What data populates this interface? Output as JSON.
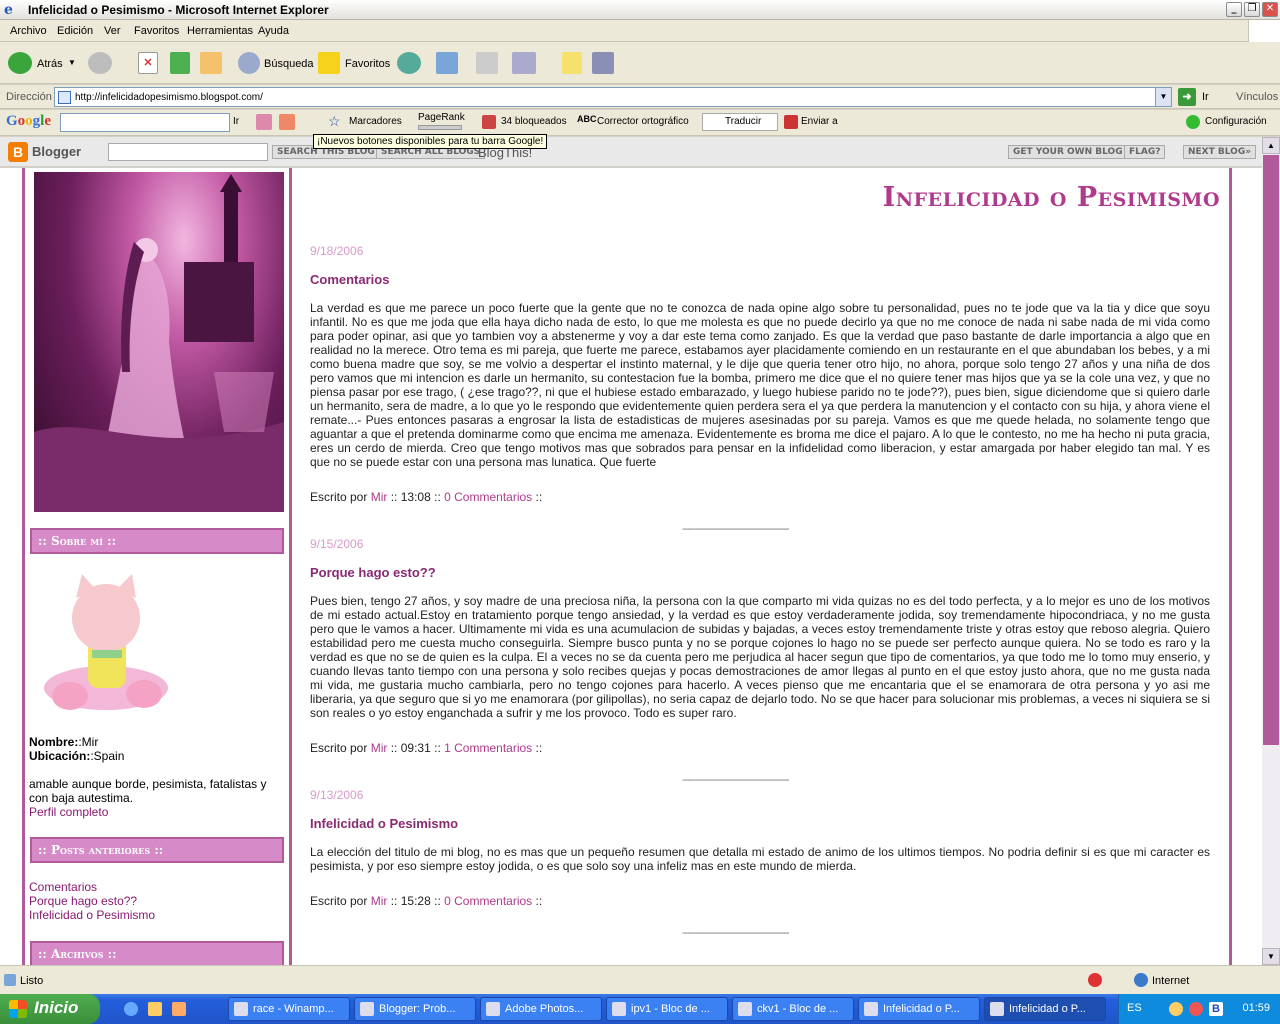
{
  "window": {
    "title": "Infelicidad o Pesimismo - Microsoft Internet Explorer"
  },
  "menu": [
    "Archivo",
    "Edición",
    "Ver",
    "Favoritos",
    "Herramientas",
    "Ayuda"
  ],
  "toolbar": {
    "back": "Atrás",
    "search": "Búsqueda",
    "favorites": "Favoritos"
  },
  "address": {
    "label": "Dirección",
    "url": "http://infelicidadopesimismo.blogspot.com/",
    "go": "Ir",
    "links": "Vínculos"
  },
  "google_bar": {
    "logo": "Google",
    "go": "Ir",
    "bookmarks": "Marcadores",
    "pagerank": "PageRank",
    "blocked": "34 bloqueados",
    "spell": "Corrector ortográfico",
    "translate": "Traducir",
    "send": "Enviar a",
    "settings": "Configuración",
    "tooltip": "¡Nuevos botones disponibles para tu barra Google!"
  },
  "blogger_bar": {
    "brand": "Blogger",
    "search_this": "SEARCH THIS BLOG",
    "search_all": "SEARCH ALL BLOGS",
    "blogthis": "BlogThis!",
    "get_own": "GET YOUR OWN BLOG",
    "flag": "FLAG?",
    "next": "NEXT BLOG»"
  },
  "blog": {
    "title": "Infelicidad o Pesimismo"
  },
  "sidebar": {
    "about_head": ":: Sobre mí ::",
    "name_label": "Nombre:",
    "name_value": ":Mir",
    "loc_label": "Ubicación:",
    "loc_value": ":Spain",
    "bio": "amable aunque borde, pesimista, fatalistas y con baja autestima.",
    "profile_link": "Perfil completo",
    "prev_head": ":: Posts anteriores ::",
    "prev_posts": [
      "Comentarios",
      "Porque hago esto??",
      "Infelicidad o Pesimismo"
    ],
    "archive_head": ":: Archivos ::"
  },
  "posts": [
    {
      "date": "9/18/2006",
      "title": "Comentarios",
      "body": "La verdad es que me parece un poco fuerte que la gente que no te conozca de nada opine algo sobre tu personalidad, pues no te jode que va la tia y dice que soyu infantil. No es que me joda que ella haya dicho nada de esto, lo que me molesta es que no puede decirlo ya que no me conoce de nada ni sabe nada de mi vida como para poder opinar, asi que yo tambien voy a abstenerme y voy a dar este tema como zanjado. Es que la verdad que paso bastante de darle importancia a algo que en realidad no la merece. Otro tema es mi pareja, que fuerte me parece, estabamos ayer placidamente comiendo en un restaurante en el que abundaban los bebes, y a mi como buena madre que soy, se me volvio a despertar el instinto maternal, y le dije que queria tener otro hijo, no ahora, porque solo tengo 27 años y una niña de dos pero vamos que mi intencion es darle un hermanito, su contestacion fue la bomba, primero me dice que el no quiere tener mas hijos que ya se la cole una vez, y que no piensa pasar por ese trago, ( ¿ese trago??, ni que el hubiese estado embarazado, y luego hubiese parido no te jode??), pues bien, sigue diciendome que si quiero darle un hermanito, sera de madre, a lo que yo le respondo que evidentemente quien perdera sera el ya que perdera la manutencion y el contacto con su hija, y ahora viene el remate...- Pues entonces pasaras a engrosar la lista de estadisticas de mujeres asesinadas por su pareja. Vamos es que me quede helada, no solamente tengo que aguantar a que el pretenda dominarme como que encima me amenaza. Evidentemente es broma me dice el pajaro. A lo que le contesto, no me ha hecho ni puta gracia, eres un cerdo de mierda. Creo que tengo motivos mas que sobrados para pensar en la infidelidad como liberacion, y estar amargada por haber elegido tan mal. Y es que no se puede estar con una persona mas lunatica. Que fuerte",
      "author": "Mir",
      "time": "13:08",
      "comments": "0 Commentarios"
    },
    {
      "date": "9/15/2006",
      "title": "Porque hago esto??",
      "body": "Pues bien, tengo 27 años, y soy madre de una preciosa niña, la persona con la que comparto mi vida quizas no es del todo perfecta, y a lo mejor es uno de los motivos de mi estado actual.Estoy en tratamiento porque tengo ansiedad, y la verdad es que estoy verdaderamente jodida, soy tremendamente hipocondriaca, y no me gusta pero que le vamos a hacer. Ultimamente mi vida es una acumulacion de subidas y bajadas, a veces estoy tremendamente triste y otras estoy que reboso alegria. Quiero estabilidad pero me cuesta mucho conseguirla. Siempre busco punta y no se porque cojones lo hago no se puede ser perfecto aunque quiera. No se todo es raro y la verdad es que no se de quien es la culpa. El a veces no se da cuenta pero me perjudica al hacer segun que tipo de comentarios, ya que todo me lo tomo muy enserio, y cuando llevas tanto tiempo con una persona y solo recibes quejas y pocas demostraciones de amor llegas al punto en el que estoy justo ahora, que no me gusta nada mi vida, me gustaria mucho cambiarla, pero no tengo cojones para hacerlo. A veces pienso que me encantaria que el se enamorara de otra persona y yo asi me liberaria, ya que seguro que si yo me enamorara (por gilipollas), no seria capaz de dejarlo todo. No se que hacer para solucionar mis problemas, a veces ni siquiera se si son reales o yo estoy enganchada a sufrir y me los provoco. Todo es super raro.",
      "author": "Mir",
      "time": "09:31",
      "comments": "1 Commentarios"
    },
    {
      "date": "9/13/2006",
      "title": "Infelicidad o Pesimismo",
      "body": "La elección del titulo de mi blog, no es mas que un pequeño resumen que detalla mi estado de animo de los ultimos tiempos. No podria definir si es que mi caracter es pesimista, y por eso siempre estoy jodida, o es que solo soy una infeliz mas en este mundo de mierda.",
      "author": "Mir",
      "time": "15:28",
      "comments": "0 Commentarios"
    }
  ],
  "post_labels": {
    "written_by": "Escrito por",
    "sep": "::",
    "divider": "----------------------------------------"
  },
  "status": {
    "text": "Listo",
    "zone": "Internet"
  },
  "taskbar": {
    "start": "Inicio",
    "tasks": [
      "race - Winamp...",
      "Blogger: Prob...",
      "Adobe Photos...",
      "ipv1 - Bloc de ...",
      "ckv1 - Bloc de ...",
      "Infelicidad o P...",
      "Infelicidad o P..."
    ],
    "lang": "ES",
    "clock": "01:59"
  }
}
